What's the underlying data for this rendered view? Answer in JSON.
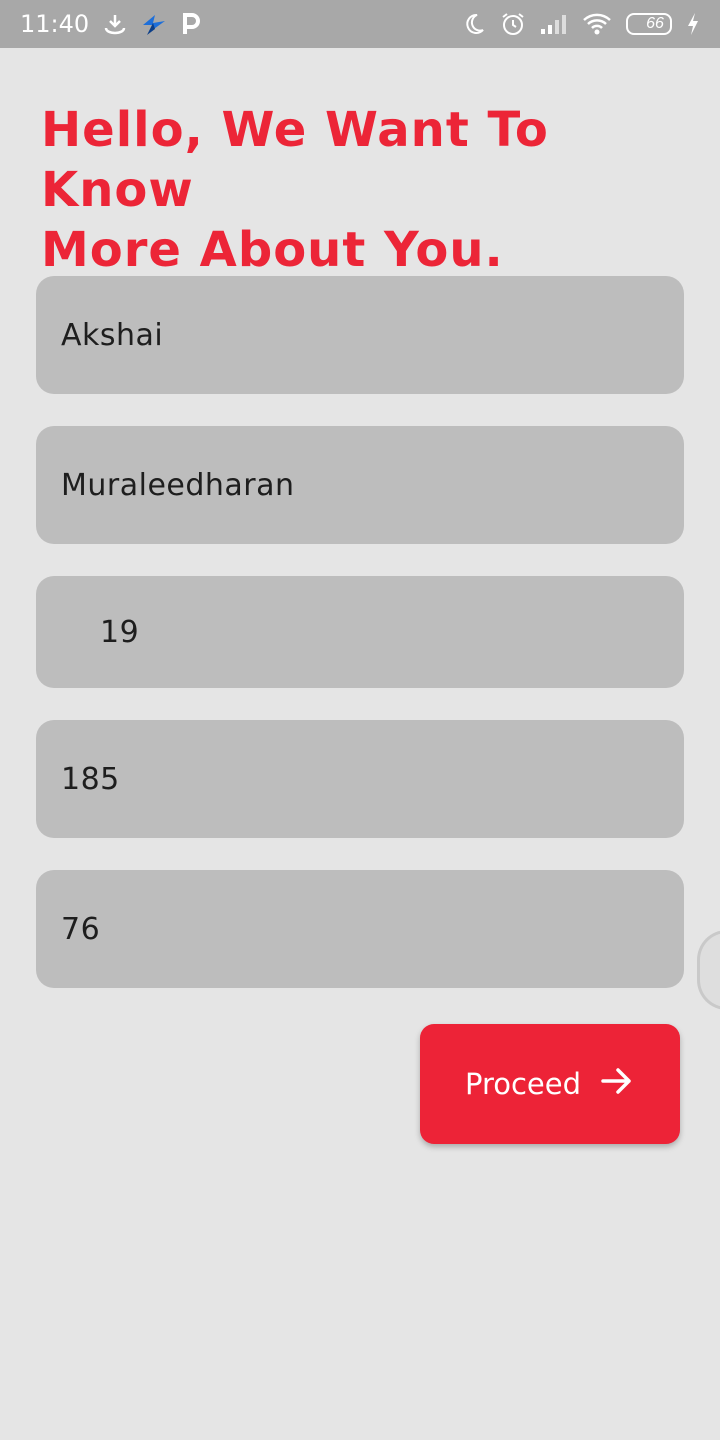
{
  "status_bar": {
    "time": "11:40",
    "left_icons": [
      "download-icon",
      "bird-app-icon",
      "parking-app-icon"
    ],
    "right_icons": [
      "moon-icon",
      "alarm-icon",
      "signal-icon",
      "wifi-icon",
      "battery-icon",
      "charging-icon"
    ],
    "battery_level": "66",
    "accent_color": "#f0a000"
  },
  "headline": {
    "line1": "Hello, We Want To Know",
    "line2": "More About You."
  },
  "form": {
    "first_name": "Akshai",
    "last_name": "Muraleedharan",
    "age": "19",
    "height": "185",
    "weight": "76"
  },
  "proceed_button": {
    "label": "Proceed",
    "icon": "arrow-right-icon",
    "color": "#ed2337"
  },
  "colors": {
    "brand_red": "#ec2537",
    "field_bg": "#bdbdbd",
    "page_bg": "#e5e5e5"
  }
}
